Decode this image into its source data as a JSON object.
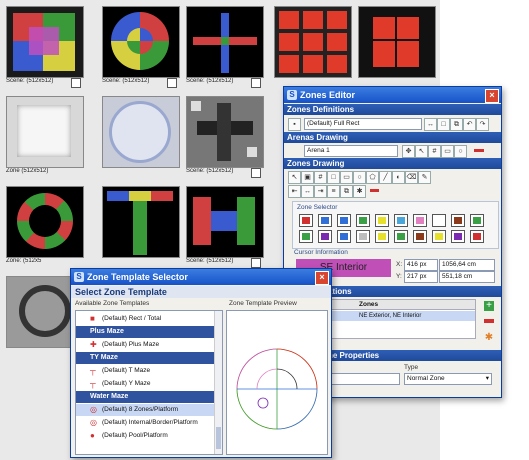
{
  "scenes": {
    "captions": [
      "Scene:",
      "(512x512)",
      "Zone",
      "(512x512)",
      "Scene:",
      "(512x512)",
      "Scene:",
      "(512x512)",
      "Zone: (512x5"
    ]
  },
  "zones_editor": {
    "title": "Zones Editor",
    "sections": {
      "definitions": "Zones Definitions",
      "arenas": "Arenas Drawing",
      "drawing": "Zones Drawing",
      "relations": "ations",
      "properties": "ne Properties"
    },
    "definition_value": "(Default) Full Rect",
    "arena_value": "Arena 1",
    "zone_selector_label": "Zone Selector",
    "cursor_label": "Cursor Information",
    "cursor_zone": "SE Interior",
    "x_label": "X:",
    "x_px": "416 px",
    "x_cm": "1056,64 cm",
    "y_label": "Y:",
    "y_px": "217 px",
    "y_cm": "551,18 cm",
    "table_header": "Zones",
    "table_value": "NE Exterior, NE Interior",
    "type_label": "Type",
    "type_value": "Normal Zone",
    "swatch_colors": [
      "#d03030",
      "#2f6fd6",
      "#2f6fd6",
      "#3aa045",
      "#e6e02a",
      "#4aa6d8",
      "#e080c0",
      "#ffffff",
      "#8a3a1a",
      "#3aa045",
      "#3aa045",
      "#7a2ab0",
      "#2f6fd6",
      "#bdbdbd",
      "#e6e02a",
      "#3aa045",
      "#8a3a1a",
      "#e6e02a",
      "#7a2ab0",
      "#d03030"
    ]
  },
  "zone_template_selector": {
    "title": "Zone Template Selector",
    "header": "Select Zone Template",
    "available_label": "Available Zone Templates",
    "preview_label": "Zone Template Preview",
    "groups": [
      {
        "type": "item",
        "label": "(Default) Rect / Total"
      },
      {
        "type": "group",
        "label": "Plus Maze"
      },
      {
        "type": "item",
        "label": "(Default) Plus Maze"
      },
      {
        "type": "group",
        "label": "TY Maze"
      },
      {
        "type": "item",
        "label": "(Default) T Maze"
      },
      {
        "type": "item",
        "label": "(Default) Y Maze"
      },
      {
        "type": "group",
        "label": "Water Maze"
      },
      {
        "type": "item",
        "label": "(Default) 8 Zones/Platform"
      },
      {
        "type": "item",
        "label": "(Default) Internal/Border/Platform"
      },
      {
        "type": "item",
        "label": "(Default) Pool/Platform"
      }
    ]
  }
}
